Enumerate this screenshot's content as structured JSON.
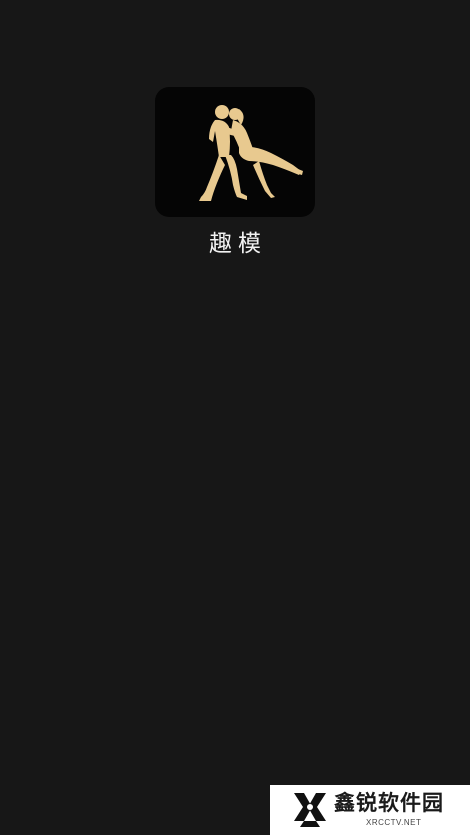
{
  "app": {
    "name": "趣模",
    "icon": "dancing-couple-icon",
    "icon_color": "#E8C98F",
    "icon_background": "#050505"
  },
  "watermark": {
    "title": "鑫锐软件园",
    "subtitle": "XRCCTV.NET",
    "logo_icon": "x-logo-icon"
  },
  "colors": {
    "background": "#171717",
    "text": "#F2F2F2"
  }
}
